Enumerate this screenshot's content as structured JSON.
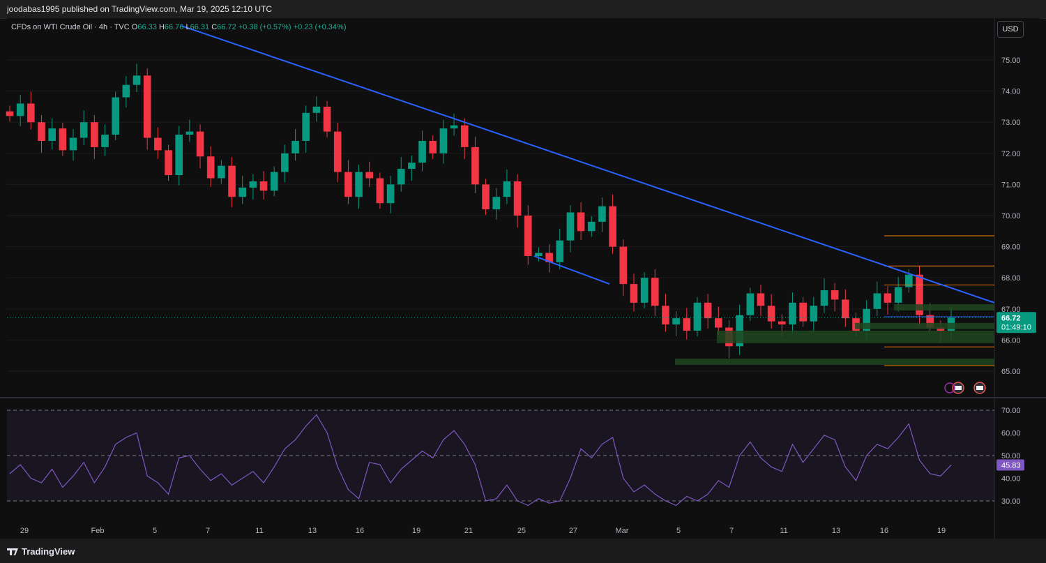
{
  "header": {
    "published_by": "joodabas1995 published on TradingView.com, Mar 19, 2025 12:10 UTC"
  },
  "legend": {
    "symbol": "CFDs on WTI Crude Oil · 4h · TVC",
    "o_label": "O",
    "o_value": "66.33",
    "h_label": "H",
    "h_value": "66.76",
    "l_label": "L",
    "l_value": "66.31",
    "c_label": "C",
    "c_value": "66.72",
    "change": "+0.38 (+0.57%)",
    "change2": "+0.23 (+0.34%)"
  },
  "currency_button": "USD",
  "price_badge": {
    "price": "66.72",
    "countdown": "01:49:10",
    "color": "#089981"
  },
  "rsi_badge": {
    "value": "45.83",
    "color": "#7e57c2"
  },
  "footer": {
    "brand": "TradingView"
  },
  "colors": {
    "up": "#089981",
    "down": "#f23645",
    "trendline": "#2962ff",
    "zone": "#1e4620",
    "level": "#f57c00",
    "rsi": "#7e57c2"
  },
  "chart_data": [
    {
      "type": "candlestick",
      "y_ticks": [
        "75.00",
        "74.00",
        "73.00",
        "72.00",
        "71.00",
        "70.00",
        "69.00",
        "68.00",
        "67.00",
        "66.00",
        "65.00"
      ],
      "ylim": [
        64.6,
        76.0
      ],
      "x_tick_labels": [
        "29",
        "Feb",
        "5",
        "7",
        "11",
        "13",
        "16",
        "19",
        "21",
        "25",
        "27",
        "Mar",
        "5",
        "7",
        "11",
        "13",
        "16",
        "19"
      ],
      "close_path": [
        73.2,
        73.6,
        73.0,
        72.4,
        72.8,
        72.1,
        72.5,
        73.0,
        72.2,
        72.6,
        73.8,
        74.2,
        74.5,
        72.5,
        72.1,
        71.3,
        72.6,
        72.7,
        71.9,
        71.2,
        71.6,
        70.6,
        70.9,
        71.1,
        70.8,
        71.4,
        72.0,
        72.4,
        73.3,
        73.5,
        72.7,
        71.4,
        70.6,
        71.4,
        71.2,
        70.4,
        71.0,
        71.5,
        71.7,
        72.4,
        72.0,
        72.8,
        72.9,
        72.2,
        71.0,
        70.2,
        70.6,
        71.1,
        70.0,
        68.7,
        68.8,
        68.5,
        69.2,
        70.1,
        69.5,
        69.8,
        70.3,
        69.0,
        67.8,
        67.2,
        68.0,
        67.1,
        66.5,
        66.7,
        66.3,
        67.2,
        66.7,
        66.4,
        65.8,
        66.8,
        67.5,
        67.1,
        66.6,
        66.5,
        67.2,
        66.6,
        67.1,
        67.6,
        67.3,
        66.7,
        66.3,
        67.0,
        67.5,
        67.2,
        67.7,
        68.1,
        66.8,
        66.4,
        66.3,
        66.72
      ],
      "rsi": [
        42,
        46,
        40,
        38,
        44,
        36,
        41,
        47,
        38,
        45,
        55,
        58,
        60,
        41,
        38,
        33,
        49,
        50,
        44,
        39,
        42,
        37,
        40,
        43,
        38,
        45,
        53,
        57,
        63,
        68,
        60,
        45,
        35,
        31,
        47,
        46,
        38,
        44,
        48,
        52,
        49,
        57,
        61,
        55,
        46,
        30,
        31,
        37,
        30,
        28,
        31,
        29,
        30,
        40,
        53,
        49,
        55,
        58,
        40,
        34,
        37,
        33,
        30,
        28,
        32,
        30,
        33,
        39,
        36,
        50,
        56,
        49,
        45,
        43,
        55,
        47,
        53,
        59,
        57,
        45,
        39,
        50,
        55,
        53,
        58,
        64,
        48,
        42,
        41,
        45.83
      ],
      "trendlines": [
        {
          "from": [
            0.0,
            76.2
          ],
          "to": [
            1.0,
            67.2
          ],
          "label": ""
        },
        {
          "from": [
            0.0,
            68.7
          ],
          "to": [
            1.0,
            67.8
          ],
          "label": ""
        }
      ],
      "horizontal_levels": [
        69.35,
        68.38,
        67.77,
        66.75,
        65.78,
        65.18
      ],
      "zones": [
        [
          66.95,
          67.15
        ],
        [
          66.35,
          66.55
        ],
        [
          65.9,
          66.3
        ],
        [
          65.2,
          65.4
        ]
      ]
    },
    {
      "type": "line",
      "name": "",
      "y_ticks": [
        "70.00",
        "60.00",
        "50.00",
        "40.00",
        "30.00"
      ],
      "ylim": [
        25,
        72
      ],
      "bands": [
        70,
        50,
        30
      ],
      "last_value": 45.83
    }
  ]
}
